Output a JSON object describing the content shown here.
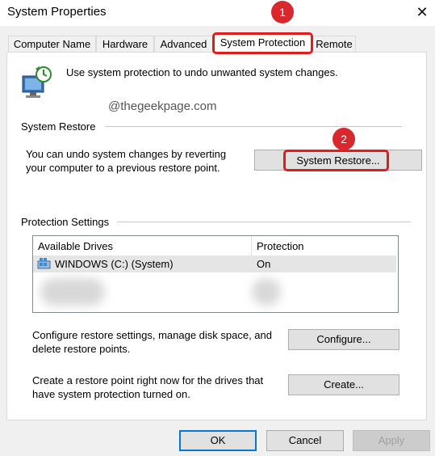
{
  "window": {
    "title": "System Properties"
  },
  "tabs": [
    {
      "label": "Computer Name"
    },
    {
      "label": "Hardware"
    },
    {
      "label": "Advanced"
    },
    {
      "label": "System Protection"
    },
    {
      "label": "Remote"
    }
  ],
  "intro": {
    "text": "Use system protection to undo unwanted system changes."
  },
  "watermark": "@thegeekpage.com",
  "system_restore": {
    "group_label": "System Restore",
    "description_line1": "You can undo system changes by reverting",
    "description_line2": "your computer to a previous restore point.",
    "button_label": "System Restore..."
  },
  "protection": {
    "group_label": "Protection Settings",
    "columns": [
      "Available Drives",
      "Protection"
    ],
    "rows": [
      {
        "drive": "WINDOWS (C:) (System)",
        "protection": "On"
      }
    ]
  },
  "configure": {
    "text_line1": "Configure restore settings, manage disk space, and",
    "text_line2": "delete restore points.",
    "button_label": "Configure..."
  },
  "create": {
    "text_line1": "Create a restore point right now for the drives that",
    "text_line2": "have system protection turned on.",
    "button_label": "Create..."
  },
  "footer": {
    "ok": "OK",
    "cancel": "Cancel",
    "apply": "Apply"
  },
  "annotations": {
    "step1": "1",
    "step2": "2",
    "highlight_color": "#e41b1b"
  }
}
